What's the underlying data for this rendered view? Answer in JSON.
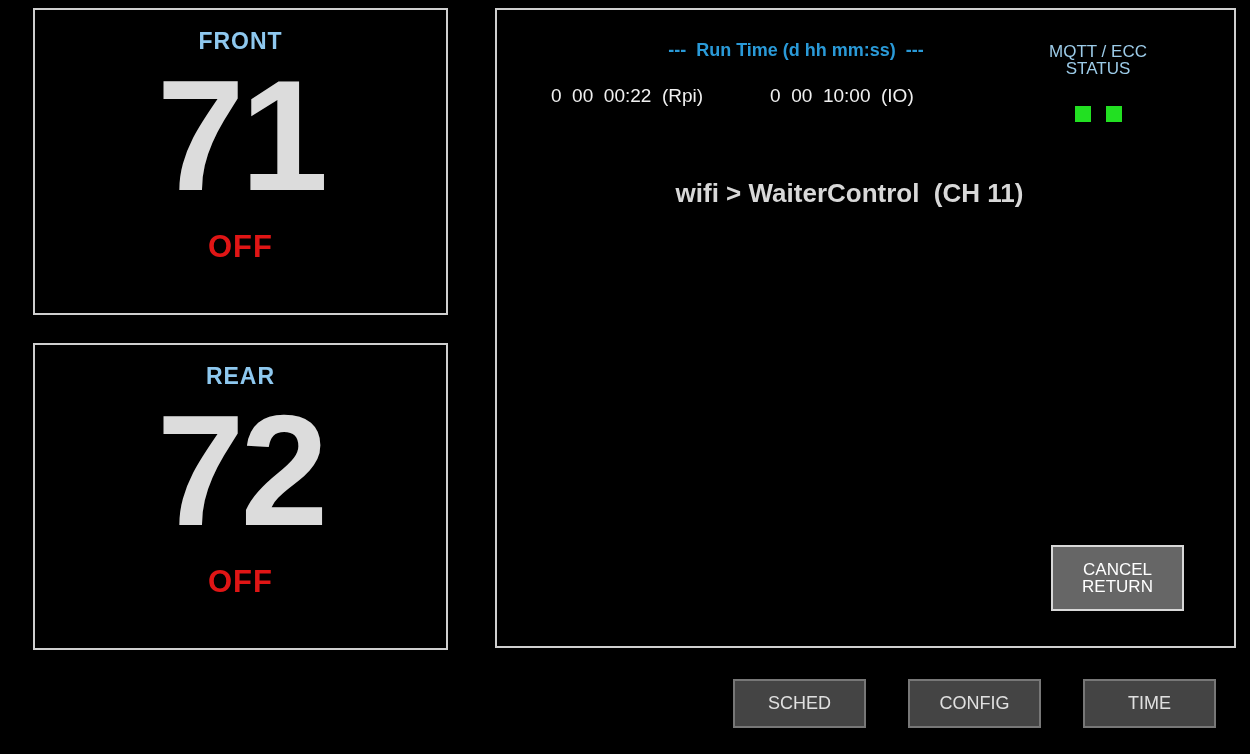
{
  "zones": [
    {
      "name": "FRONT",
      "temperature": "71",
      "state": "OFF",
      "on": false
    },
    {
      "name": "REAR",
      "temperature": "72",
      "state": "OFF",
      "on": false
    }
  ],
  "main_panel": {
    "run_time_title": "---  Run Time (d hh mm:ss)  ---",
    "run_times": [
      "0  00  00:22  (Rpi)",
      "0  00  10:00  (IO)"
    ],
    "status_label": [
      "MQTT / ECC",
      "STATUS"
    ],
    "status_indicators": [
      {
        "color": "#22e022"
      },
      {
        "color": "#22e022"
      }
    ],
    "wifi": "wifi > WaiterControl  (CH 11)",
    "cancel_button": [
      "CANCEL",
      "RETURN"
    ]
  },
  "nav_buttons": [
    "SCHED",
    "CONFIG",
    "TIME"
  ]
}
